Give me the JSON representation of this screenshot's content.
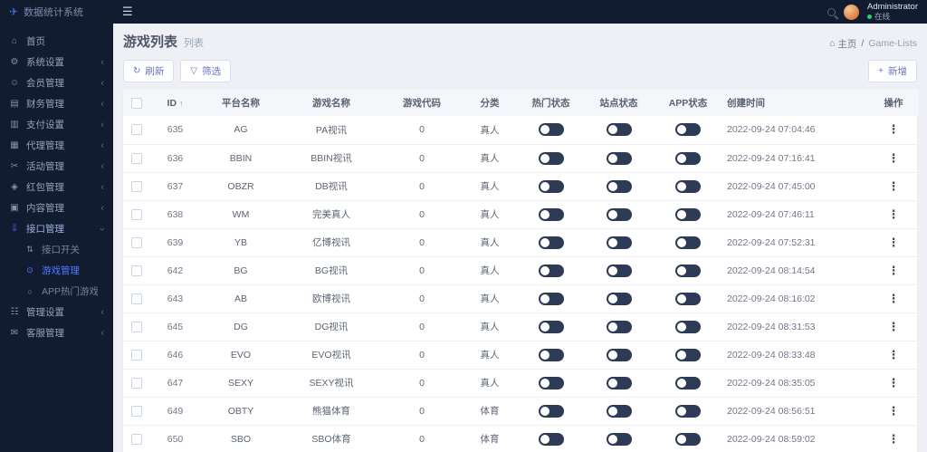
{
  "app": {
    "logo_glyph": "✈",
    "title": "数据统计系统"
  },
  "topbar": {
    "menu_icon": "☰",
    "user": {
      "name": "Administrator",
      "status": "在线"
    }
  },
  "sidebar": {
    "items": [
      {
        "name": "sidebar-item-home",
        "label": "首页",
        "icon": "home-icon",
        "glyph": "⌂",
        "arrow": "",
        "state": "normal"
      },
      {
        "name": "sidebar-item-system-settings",
        "label": "系统设置",
        "icon": "gear-icon",
        "glyph": "⚙",
        "arrow": "‹",
        "state": "normal"
      },
      {
        "name": "sidebar-item-members",
        "label": "会员管理",
        "icon": "user-icon",
        "glyph": "☺",
        "arrow": "‹",
        "state": "normal"
      },
      {
        "name": "sidebar-item-finance",
        "label": "财务管理",
        "icon": "ledger-icon",
        "glyph": "▤",
        "arrow": "‹",
        "state": "normal"
      },
      {
        "name": "sidebar-item-payment",
        "label": "支付设置",
        "icon": "payment-icon",
        "glyph": "▥",
        "arrow": "‹",
        "state": "normal"
      },
      {
        "name": "sidebar-item-agents",
        "label": "代理管理",
        "icon": "agent-icon",
        "glyph": "▦",
        "arrow": "‹",
        "state": "normal"
      },
      {
        "name": "sidebar-item-activities",
        "label": "活动管理",
        "icon": "scissors-icon",
        "glyph": "✂",
        "arrow": "‹",
        "state": "normal"
      },
      {
        "name": "sidebar-item-redpacket",
        "label": "红包管理",
        "icon": "redpacket-icon",
        "glyph": "◈",
        "arrow": "‹",
        "state": "normal"
      },
      {
        "name": "sidebar-item-content",
        "label": "内容管理",
        "icon": "content-icon",
        "glyph": "▣",
        "arrow": "‹",
        "state": "normal"
      },
      {
        "name": "sidebar-item-interface",
        "label": "接口管理",
        "icon": "download-icon",
        "glyph": "⇩",
        "arrow": "‹",
        "state": "open"
      },
      {
        "name": "sidebar-item-interface-switch",
        "label": "接口开关",
        "icon": "switch-icon",
        "glyph": "⇅",
        "arrow": "",
        "state": "sub"
      },
      {
        "name": "sidebar-item-game-management",
        "label": "游戏管理",
        "icon": "game-icon",
        "glyph": "⊙",
        "arrow": "",
        "state": "sub-active"
      },
      {
        "name": "sidebar-item-app-hot-games",
        "label": "APP热门游戏",
        "icon": "hot-game-icon",
        "glyph": "○",
        "arrow": "",
        "state": "sub"
      },
      {
        "name": "sidebar-item-admin-settings",
        "label": "管理设置",
        "icon": "settings-icon",
        "glyph": "☷",
        "arrow": "‹",
        "state": "normal"
      },
      {
        "name": "sidebar-item-service",
        "label": "客服管理",
        "icon": "chat-icon",
        "glyph": "✉",
        "arrow": "‹",
        "state": "normal"
      }
    ]
  },
  "page": {
    "title": "游戏列表",
    "subtitle": "列表",
    "breadcrumb": {
      "home_icon": "⌂",
      "home": "主页",
      "separator": "/",
      "current": "Game-Lists"
    }
  },
  "toolbar": {
    "refresh": {
      "icon": "↻",
      "label": "刷新"
    },
    "filter": {
      "icon": "▽",
      "label": "筛选"
    },
    "add": {
      "icon": "+",
      "label": "新增"
    }
  },
  "table": {
    "sort_icon": "↑",
    "actions_icon": "⋮",
    "columns": {
      "id": "ID",
      "platform": "平台名称",
      "game": "游戏名称",
      "code": "游戏代码",
      "category": "分类",
      "hot": "热门状态",
      "site": "站点状态",
      "app": "APP状态",
      "created": "创建时间",
      "actions": "操作"
    },
    "rows": [
      {
        "id": "635",
        "platform": "AG",
        "game": "PA视讯",
        "code": "0",
        "category": "真人",
        "hot": false,
        "site": false,
        "app": false,
        "created": "2022-09-24 07:04:46"
      },
      {
        "id": "636",
        "platform": "BBIN",
        "game": "BBIN视讯",
        "code": "0",
        "category": "真人",
        "hot": false,
        "site": false,
        "app": false,
        "created": "2022-09-24 07:16:41"
      },
      {
        "id": "637",
        "platform": "OBZR",
        "game": "DB视讯",
        "code": "0",
        "category": "真人",
        "hot": false,
        "site": false,
        "app": false,
        "created": "2022-09-24 07:45:00"
      },
      {
        "id": "638",
        "platform": "WM",
        "game": "完美真人",
        "code": "0",
        "category": "真人",
        "hot": false,
        "site": false,
        "app": false,
        "created": "2022-09-24 07:46:11"
      },
      {
        "id": "639",
        "platform": "YB",
        "game": "亿博视讯",
        "code": "0",
        "category": "真人",
        "hot": false,
        "site": false,
        "app": false,
        "created": "2022-09-24 07:52:31"
      },
      {
        "id": "642",
        "platform": "BG",
        "game": "BG视讯",
        "code": "0",
        "category": "真人",
        "hot": false,
        "site": false,
        "app": false,
        "created": "2022-09-24 08:14:54"
      },
      {
        "id": "643",
        "platform": "AB",
        "game": "欧博视讯",
        "code": "0",
        "category": "真人",
        "hot": false,
        "site": false,
        "app": false,
        "created": "2022-09-24 08:16:02"
      },
      {
        "id": "645",
        "platform": "DG",
        "game": "DG视讯",
        "code": "0",
        "category": "真人",
        "hot": false,
        "site": false,
        "app": false,
        "created": "2022-09-24 08:31:53"
      },
      {
        "id": "646",
        "platform": "EVO",
        "game": "EVO视讯",
        "code": "0",
        "category": "真人",
        "hot": false,
        "site": false,
        "app": false,
        "created": "2022-09-24 08:33:48"
      },
      {
        "id": "647",
        "platform": "SEXY",
        "game": "SEXY视讯",
        "code": "0",
        "category": "真人",
        "hot": false,
        "site": false,
        "app": false,
        "created": "2022-09-24 08:35:05"
      },
      {
        "id": "649",
        "platform": "OBTY",
        "game": "熊猫体育",
        "code": "0",
        "category": "体育",
        "hot": false,
        "site": false,
        "app": false,
        "created": "2022-09-24 08:56:51"
      },
      {
        "id": "650",
        "platform": "SBO",
        "game": "SBO体育",
        "code": "0",
        "category": "体育",
        "hot": false,
        "site": false,
        "app": false,
        "created": "2022-09-24 08:59:02"
      }
    ]
  }
}
